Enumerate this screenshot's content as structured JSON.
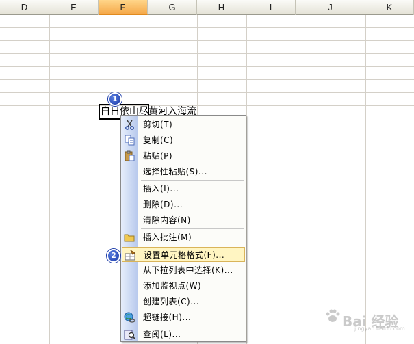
{
  "columns": [
    "D",
    "E",
    "F",
    "G",
    "H",
    "I",
    "J",
    "K"
  ],
  "active_column": "F",
  "cell": {
    "text": "白日依山尽黄河入海流"
  },
  "callouts": [
    "1",
    "2"
  ],
  "menu": {
    "items": {
      "cut": "剪切(T)",
      "copy": "复制(C)",
      "paste": "粘贴(P)",
      "paste_special": "选择性粘贴(S)...",
      "insert": "插入(I)...",
      "delete": "删除(D)...",
      "clear_contents": "清除内容(N)",
      "insert_comment": "插入批注(M)",
      "format_cells": "设置单元格格式(F)...",
      "pick_from_list": "从下拉列表中选择(K)...",
      "add_watch": "添加监视点(W)",
      "create_list": "创建列表(C)...",
      "hyperlink": "超链接(H)...",
      "lookup": "查阅(L)..."
    },
    "highlighted": "format_cells"
  },
  "watermark": {
    "text": "Bai 经验",
    "sub": "jingyan.baidu.com"
  },
  "colors": {
    "highlight": "#fff5c2",
    "gutter": "#b6c8ec",
    "badge": "#1a3aa8",
    "active_header": "#f5a94a"
  }
}
